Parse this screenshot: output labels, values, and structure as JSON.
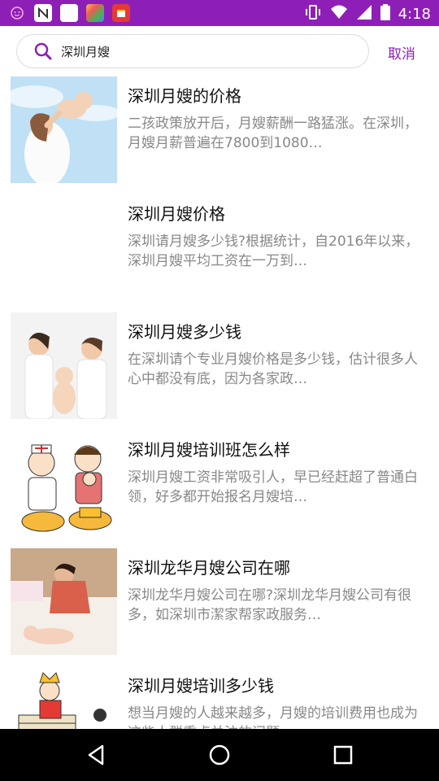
{
  "status_bar": {
    "time": "4:18",
    "left_icons": [
      "app-icon",
      "n-icon",
      "square-icon",
      "puzzle-icon",
      "calendar-icon"
    ],
    "right_icons": [
      "vibrate-icon",
      "wifi-icon",
      "signal-icon",
      "battery-icon"
    ]
  },
  "search": {
    "query": "深圳月嫂",
    "cancel_label": "取消"
  },
  "results": [
    {
      "title": "深圳月嫂的价格",
      "desc": "二孩政策放开后，月嫂薪酬一路猛涨。在深圳，月嫂月薪普遍在7800到1080…",
      "thumb": "mother-baby-photo"
    },
    {
      "title": "深圳月嫂价格",
      "desc": "深圳请月嫂多少钱?根据统计，自2016年以来，深圳月嫂平均工资在一万到…",
      "thumb": ""
    },
    {
      "title": "深圳月嫂多少钱",
      "desc": "在深圳请个专业月嫂价格是多少钱，估计很多人心中都没有底，因为各家政…",
      "thumb": "nanny-baby-photo"
    },
    {
      "title": "深圳月嫂培训班怎么样",
      "desc": "深圳月嫂工资非常吸引人，早已经赶超了普通白领，好多都开始报名月嫂培…",
      "thumb": "cartoon-illustration"
    },
    {
      "title": "深圳龙华月嫂公司在哪",
      "desc": "深圳龙华月嫂公司在哪?深圳龙华月嫂公司有很多，如深圳市潔家帮家政服务…",
      "thumb": "nanny-bed-photo"
    },
    {
      "title": "深圳月嫂培训多少钱",
      "desc": "想当月嫂的人越来越多，月嫂的培训费用也成为这些人群重点关注的问题…",
      "thumb": "cartoon-money-illustration"
    }
  ],
  "colors": {
    "accent": "#8e1fb6",
    "title_text": "#111111",
    "desc_text": "#888888"
  }
}
